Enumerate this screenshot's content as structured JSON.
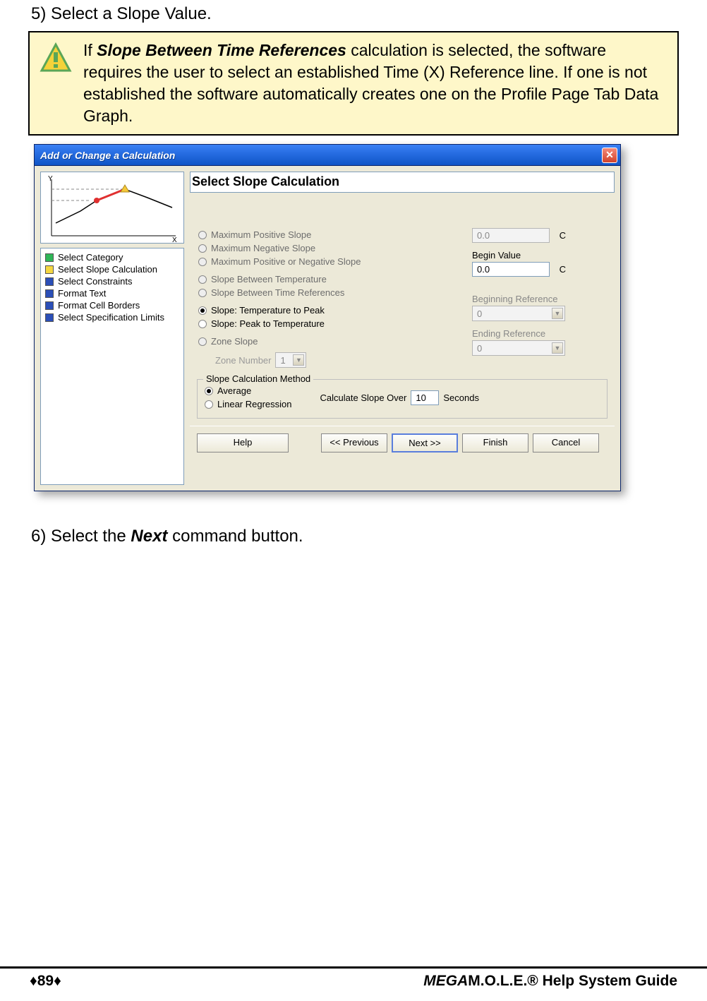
{
  "step5": "5)  Select a Slope Value.",
  "note": {
    "prefix": "If ",
    "em": "Slope Between Time References",
    "rest": " calculation is selected, the software requires the user to select an established Time (X) Reference line. If one is not established the software automatically creates one on the Profile Page Tab Data Graph."
  },
  "dialog": {
    "title": "Add or Change a Calculation",
    "section_title": "Select Slope Calculation",
    "steps": [
      {
        "label": "Select Category",
        "color": "#2fb657"
      },
      {
        "label": "Select Slope Calculation",
        "color": "#f5d742"
      },
      {
        "label": "Select Constraints",
        "color": "#2b4fb8"
      },
      {
        "label": "Format Text",
        "color": "#2b4fb8"
      },
      {
        "label": "Format Cell Borders",
        "color": "#2b4fb8"
      },
      {
        "label": "Select Specification Limits",
        "color": "#2b4fb8"
      }
    ],
    "radios": [
      {
        "label": "Maximum Positive Slope",
        "enabled": false,
        "selected": false
      },
      {
        "label": "Maximum Negative Slope",
        "enabled": false,
        "selected": false
      },
      {
        "label": "Maximum Positive or Negative Slope",
        "enabled": false,
        "selected": false
      },
      {
        "label": "Slope Between Temperature",
        "enabled": false,
        "selected": false
      },
      {
        "label": "Slope Between Time References",
        "enabled": false,
        "selected": false
      },
      {
        "label": "Slope: Temperature to Peak",
        "enabled": true,
        "selected": true
      },
      {
        "label": "Slope: Peak to Temperature",
        "enabled": true,
        "selected": false
      },
      {
        "label": "Zone Slope",
        "enabled": false,
        "selected": false
      }
    ],
    "zone_label": "Zone Number",
    "zone_value": "1",
    "fields": {
      "top_value": "0.0",
      "top_unit": "C",
      "begin_label": "Begin Value",
      "begin_value": "0.0",
      "begin_unit": "C",
      "begin_ref_label": "Beginning Reference",
      "begin_ref_value": "0",
      "end_ref_label": "Ending Reference",
      "end_ref_value": "0"
    },
    "method": {
      "legend": "Slope Calculation Method",
      "avg": "Average",
      "lin": "Linear Regression",
      "calc_label_a": "Calculate Slope Over",
      "calc_value": "10",
      "calc_label_b": "Seconds"
    },
    "buttons": {
      "help": "Help",
      "prev": "<< Previous",
      "next": "Next >>",
      "finish": "Finish",
      "cancel": "Cancel"
    }
  },
  "step6": {
    "prefix": "6)  Select the ",
    "em": "Next",
    "suffix": " command button."
  },
  "footer": {
    "page": "♦89♦",
    "guide_em": "MEGA",
    "guide_rest": "M.O.L.E.® Help System Guide"
  }
}
